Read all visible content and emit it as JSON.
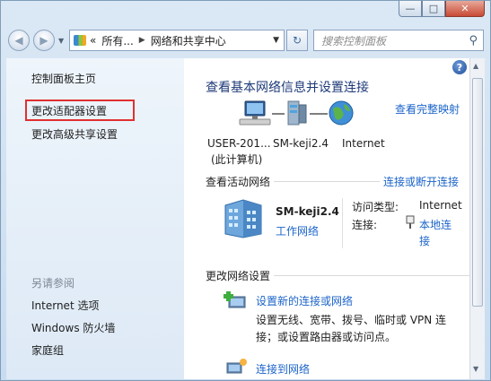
{
  "window": {
    "minimize_glyph": "—",
    "maximize_glyph": "□",
    "close_glyph": "✕"
  },
  "navbar": {
    "back_glyph": "◀",
    "forward_glyph": "▶",
    "history_dd_glyph": "▼",
    "address_segments": [
      "«",
      "所有...",
      "▶",
      "网络和共享中心"
    ],
    "address_dd_glyph": "▼",
    "refresh_glyph": "↻",
    "search_placeholder": "搜索控制面板",
    "search_glyph": "⚲"
  },
  "sidebar": {
    "home_link": "控制面板主页",
    "adapter_link": "更改适配器设置",
    "sharing_link": "更改高级共享设置",
    "see_also_heading": "另请参阅",
    "see_also": [
      "Internet 选项",
      "Windows 防火墙",
      "家庭组"
    ]
  },
  "main": {
    "title": "查看基本网络信息并设置连接",
    "full_map_link": "查看完整映射",
    "map": {
      "computer_line1": "USER-201...",
      "computer_line2": "(此计算机)",
      "network": "SM-keji2.4",
      "internet": "Internet"
    },
    "active_heading": "查看活动网络",
    "connect_disconnect_link": "连接或断开连接",
    "network_name": "SM-keji2.4",
    "network_type": "工作网络",
    "access_type_label": "访问类型:",
    "access_type_value": "Internet",
    "connection_label": "连接:",
    "connection_value_line1": "本地连",
    "connection_value_line2": "接",
    "change_heading": "更改网络设置",
    "setup_link": "设置新的连接或网络",
    "setup_desc_line1": "设置无线、宽带、拨号、临时或 VPN 连",
    "setup_desc_line2": "接；或设置路由器或访问点。",
    "connect_to_link": "连接到网络",
    "help_glyph": "?"
  },
  "colors": {
    "link": "#1c64c9",
    "title": "#1e3a78",
    "highlight_border": "#e03030"
  }
}
